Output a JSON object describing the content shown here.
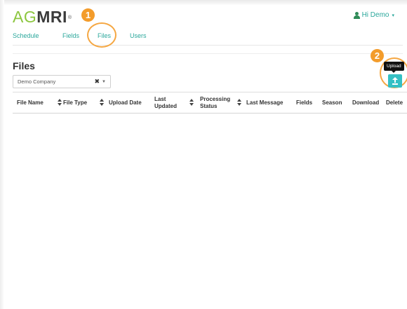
{
  "header": {
    "logo": {
      "ag": "AG",
      "mri": "MRI",
      "reg": "®"
    },
    "user_menu": {
      "label": "Hi Demo",
      "icon": "user-icon",
      "caret_icon": "caret-down-icon"
    }
  },
  "nav": {
    "tabs": [
      {
        "label": "Schedule"
      },
      {
        "label": "Fields"
      },
      {
        "label": "Files",
        "active": true
      },
      {
        "label": "Users"
      }
    ]
  },
  "annotations": {
    "step1": "1",
    "step2": "2"
  },
  "page": {
    "title": "Files",
    "company_select": {
      "value": "Demo Company",
      "clear_icon": "clear-x-icon",
      "dropdown_icon": "caret-down-icon"
    },
    "upload": {
      "tooltip": "Upload",
      "icon": "upload-icon"
    }
  },
  "table": {
    "columns": [
      {
        "label": "File Name",
        "sortable": true
      },
      {
        "label": "File Type",
        "sortable": true
      },
      {
        "label": "Upload Date",
        "sortable": true
      },
      {
        "label": "Last Updated",
        "sortable": true
      },
      {
        "label": "Processing Status",
        "sortable": true
      },
      {
        "label": "Last Message",
        "sortable": false
      },
      {
        "label": "Fields",
        "sortable": false
      },
      {
        "label": "Season",
        "sortable": false
      },
      {
        "label": "Download",
        "sortable": false
      },
      {
        "label": "Delete",
        "sortable": false
      }
    ],
    "rows": []
  },
  "colors": {
    "brand_green": "#8cc63f",
    "link_teal": "#2aa79b",
    "accent_cyan": "#35c0c4",
    "annotation_orange": "#f39c2b"
  }
}
